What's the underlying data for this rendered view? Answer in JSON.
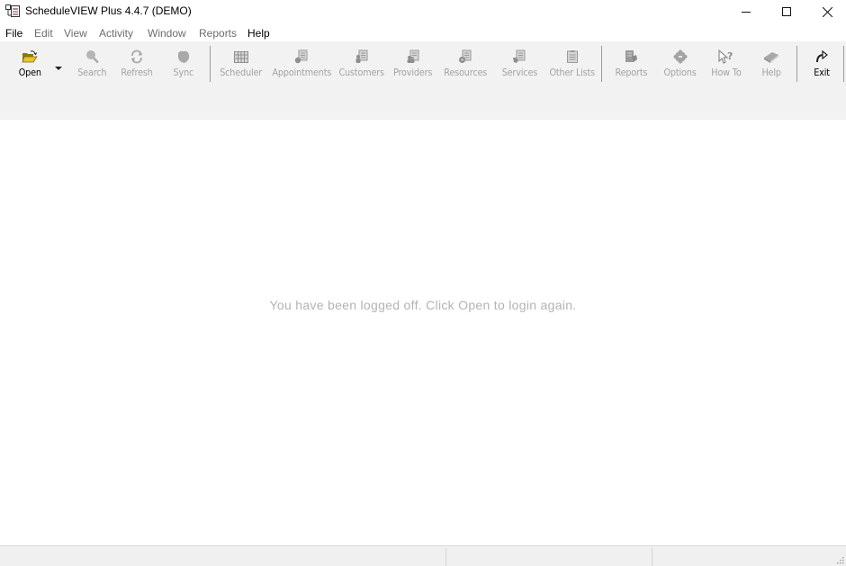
{
  "window": {
    "title": "ScheduleVIEW Plus 4.4.7  (DEMO)",
    "controls": {
      "minimize": "–",
      "maximize": "☐",
      "close": "✕"
    }
  },
  "menu": {
    "items": [
      {
        "label": "File",
        "enabled": true
      },
      {
        "label": "Edit",
        "enabled": false
      },
      {
        "label": "View",
        "enabled": false
      },
      {
        "label": "Activity",
        "enabled": false
      },
      {
        "label": "Window",
        "enabled": false
      },
      {
        "label": "Reports",
        "enabled": false
      },
      {
        "label": "Help",
        "enabled": true
      }
    ]
  },
  "toolbar": {
    "buttons": [
      {
        "label": "Open",
        "icon": "folder-open-icon",
        "enabled": true
      },
      {
        "label": "Search",
        "icon": "magnifier-icon",
        "enabled": false
      },
      {
        "label": "Refresh",
        "icon": "refresh-icon",
        "enabled": false
      },
      {
        "label": "Sync",
        "icon": "sync-icon",
        "enabled": false
      },
      {
        "label": "Scheduler",
        "icon": "grid-calendar-icon",
        "enabled": false
      },
      {
        "label": "Appointments",
        "icon": "clipboard-clock-icon",
        "enabled": false
      },
      {
        "label": "Customers",
        "icon": "clipboard-person-icon",
        "enabled": false
      },
      {
        "label": "Providers",
        "icon": "clipboard-people-icon",
        "enabled": false
      },
      {
        "label": "Resources",
        "icon": "clipboard-gear-icon",
        "enabled": false
      },
      {
        "label": "Services",
        "icon": "clipboard-tool-icon",
        "enabled": false
      },
      {
        "label": "Other Lists",
        "icon": "clipboard-list-icon",
        "enabled": false
      },
      {
        "label": "Reports",
        "icon": "report-icon",
        "enabled": false
      },
      {
        "label": "Options",
        "icon": "gear-icon",
        "enabled": false
      },
      {
        "label": "How To",
        "icon": "pointer-question-icon",
        "enabled": false
      },
      {
        "label": "Help",
        "icon": "book-icon",
        "enabled": false
      },
      {
        "label": "Exit",
        "icon": "exit-arrow-icon",
        "enabled": true
      }
    ]
  },
  "main": {
    "message": "You have been logged off. Click Open to login again."
  },
  "colors": {
    "toolbar_bg": "#f2f2f3",
    "disabled_text": "#a3a3a3",
    "message_text": "#b3b3b3",
    "folder_yellow": "#d9b92a"
  }
}
